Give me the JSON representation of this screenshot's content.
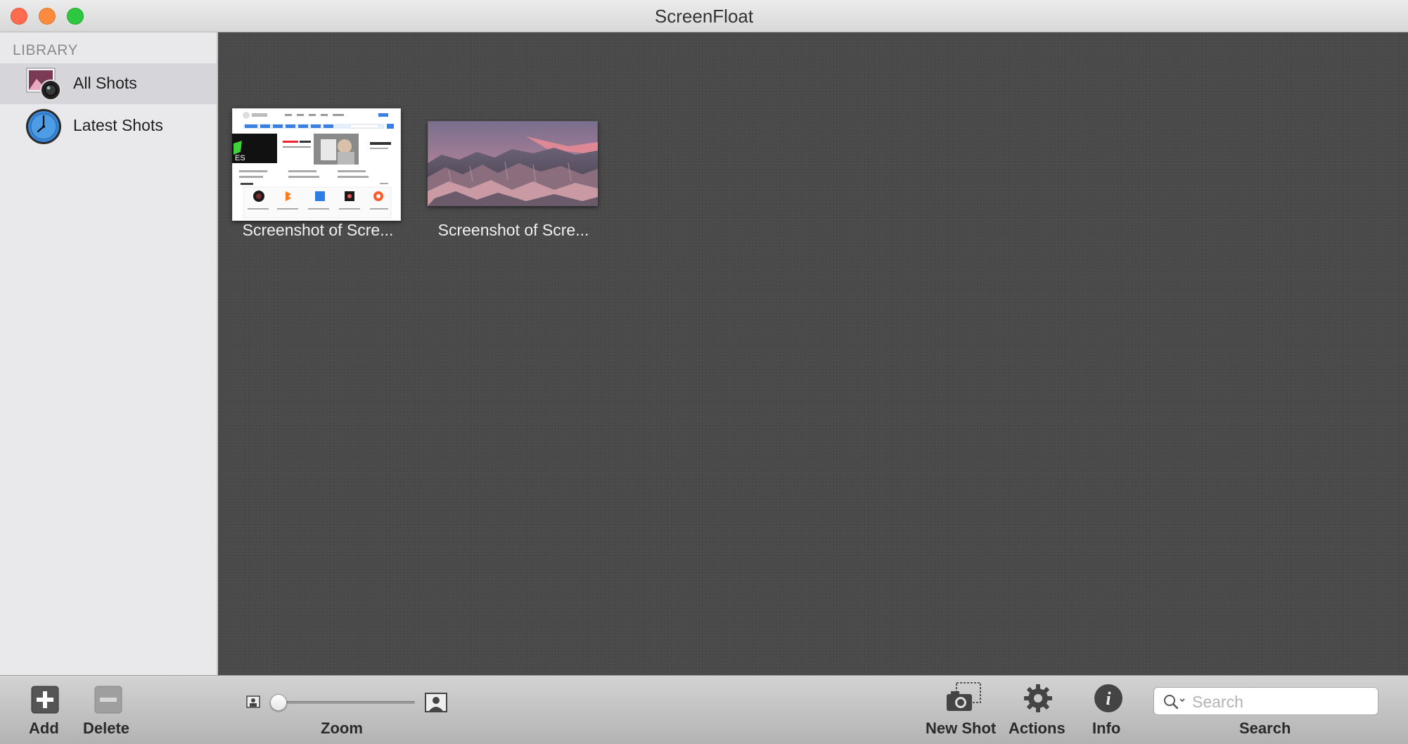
{
  "window": {
    "title": "ScreenFloat"
  },
  "sidebar": {
    "heading": "LIBRARY",
    "items": [
      {
        "label": "All Shots",
        "icon": "camera-photo-icon",
        "selected": true
      },
      {
        "label": "Latest Shots",
        "icon": "clock-icon",
        "selected": false
      }
    ]
  },
  "shots": [
    {
      "caption": "Screenshot of Scre...",
      "thumbnail": "website-screenshot-thumbnail"
    },
    {
      "caption": "Screenshot of Scre...",
      "thumbnail": "mountain-landscape-thumbnail"
    }
  ],
  "toolbar": {
    "add_label": "Add",
    "delete_label": "Delete",
    "zoom_label": "Zoom",
    "zoom_level": 0.0,
    "new_shot_label": "New Shot",
    "actions_label": "Actions",
    "info_label": "Info",
    "search_label": "Search",
    "search_placeholder": "Search"
  },
  "colors": {
    "close": "#fe6b4e",
    "minimize": "#fd8a3d",
    "zoom": "#2ec840",
    "content_background": "#4a4a4a",
    "sidebar_background": "#e9e9ec",
    "selection": "#d6d6da"
  }
}
